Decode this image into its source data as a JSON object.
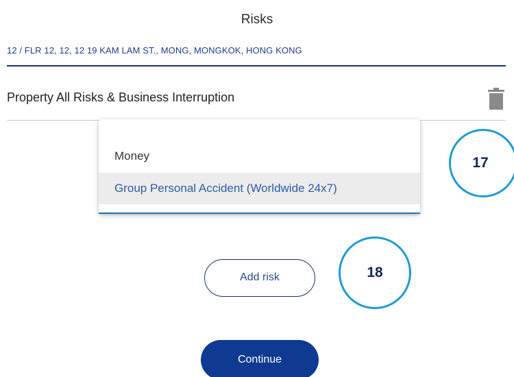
{
  "header": {
    "title": "Risks"
  },
  "location": {
    "address": "12 / FLR 12, 12, 12 19 KAM LAM ST., MONG, MONGKOK, HONG KONG"
  },
  "risks": [
    {
      "label": "Property All Risks & Business Interruption",
      "delete_icon": "trash-icon"
    }
  ],
  "risk_dropdown": {
    "options": [
      {
        "label": "Money"
      },
      {
        "label": "Group Personal Accident (Worldwide 24x7)",
        "highlighted": true
      }
    ]
  },
  "annotations": {
    "callout_1": "17",
    "callout_2": "18"
  },
  "actions": {
    "add_risk_label": "Add risk",
    "continue_label": "Continue"
  },
  "colors": {
    "brand_navy": "#0f3a92",
    "link_blue": "#2d5ca8",
    "callout_ring": "#1e9bd7",
    "trash_gray": "#8a8a8a"
  }
}
